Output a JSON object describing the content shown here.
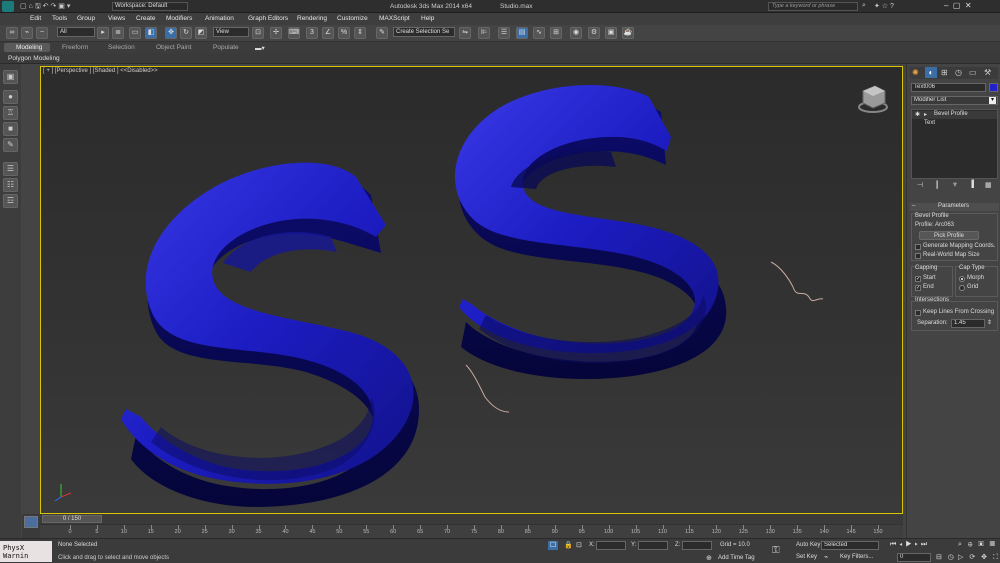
{
  "title_bar": {
    "workspace": "Workspace: Default",
    "app_title": "Autodesk 3ds Max  2014 x64",
    "file_name": "Studio.max",
    "search_placeholder": "Type a keyword or phrase"
  },
  "menu": [
    "Edit",
    "Tools",
    "Group",
    "Views",
    "Create",
    "Modifiers",
    "Animation",
    "Graph Editors",
    "Rendering",
    "Customize",
    "MAXScript",
    "Help"
  ],
  "toolbar": {
    "selection_filter": "All",
    "reference_coord": "View",
    "named_selection": "Create Selection Se"
  },
  "ribbon": {
    "tabs": [
      "Modeling",
      "Freeform",
      "Selection",
      "Object Paint",
      "Populate"
    ],
    "subtitle": "Polygon Modeling"
  },
  "viewport": {
    "label": "[ + ] [Perspective ] [Shaded ]",
    "disabled_label": "<<Disabled>>"
  },
  "command_panel": {
    "object_name": "Text006",
    "modifier_list": "Modifier List",
    "stack": [
      "Bevel Profile",
      "Text"
    ],
    "parameters_title": "Parameters",
    "bevel_profile_group": "Bevel Profile",
    "profile_label": "Profile: Arc063",
    "pick_profile_button": "Pick Profile",
    "generate_mapping": "Generate Mapping Coords.",
    "real_world_map": "Real-World Map Size",
    "capping_group": "Capping",
    "cap_start": "Start",
    "cap_end": "End",
    "cap_type_group": "Cap Type",
    "morph": "Morph",
    "grid": "Grid",
    "intersections_group": "Intersections",
    "keep_lines": "Keep Lines From Crossing",
    "separation_label": "Separation:",
    "separation_value": "1.45"
  },
  "timeline": {
    "frame_counter": "0 / 150",
    "ticks": [
      "0",
      "5",
      "10",
      "15",
      "20",
      "25",
      "30",
      "35",
      "40",
      "45",
      "50",
      "55",
      "60",
      "65",
      "70",
      "75",
      "80",
      "85",
      "90",
      "95",
      "100",
      "105",
      "110",
      "115",
      "120",
      "125",
      "130",
      "135",
      "140",
      "145",
      "150"
    ]
  },
  "status_bar": {
    "maxscript": "PhysX Warnin",
    "selection_status": "None Selected",
    "prompt": "Click and drag to select and move objects",
    "x_label": "X:",
    "y_label": "Y:",
    "z_label": "Z:",
    "grid": "Grid = 10.0",
    "add_time_tag": "Add Time Tag",
    "auto_key": "Auto Key",
    "auto_key_mode": "Selected",
    "set_key": "Set Key",
    "key_filters": "Key Filters...",
    "current_frame": "0"
  },
  "colors": {
    "viewport_border": "#d8c600",
    "text_object": "#1f1fd6",
    "spline": "#c9a9a0"
  }
}
